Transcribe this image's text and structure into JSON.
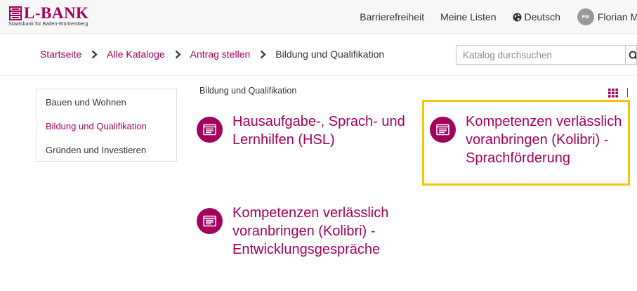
{
  "colors": {
    "brand": "#a3005e",
    "highlight": "#f4c500",
    "header_bg": "#f7f7f7",
    "text": "#333333"
  },
  "header": {
    "logo": {
      "wordmark": "L-BANK",
      "subtitle": "Staatsbank für Baden-Württemberg"
    },
    "nav": {
      "accessibility": "Barrierefreiheit",
      "my_lists": "Meine Listen",
      "language": "Deutsch",
      "language_icon": "globe-icon"
    },
    "user": {
      "initials": "FM",
      "name": "Florian Mu"
    }
  },
  "breadcrumb": {
    "items": [
      "Startseite",
      "Alle Kataloge",
      "Antrag stellen",
      "Bildung und Qualifikation"
    ],
    "separator_icon": "chevron-right-icon"
  },
  "search": {
    "placeholder": "Katalog durchsuchen",
    "value": "",
    "button_icon": "search-icon"
  },
  "sidebar": {
    "items": [
      {
        "label": "Bauen und Wohnen",
        "active": false
      },
      {
        "label": "Bildung und Qualifikation",
        "active": true
      },
      {
        "label": "Gründen und Investieren",
        "active": false
      }
    ]
  },
  "main": {
    "section_title": "Bildung und Qualifikation",
    "view_toggle_icon": "grid-view-icon",
    "tiles": [
      {
        "title": "Hausaufgabe-, Sprach- und Lernhilfen (HSL)",
        "icon": "form-document-icon",
        "highlighted": false
      },
      {
        "title": "Kompetenzen verlässlich voranbringen (Kolibri) - Sprachförderung",
        "icon": "form-document-icon",
        "highlighted": true
      },
      {
        "title": "Kompetenzen verlässlich voranbringen (Kolibri) - Entwicklungsgespräche",
        "icon": "form-document-icon",
        "highlighted": false
      }
    ]
  }
}
